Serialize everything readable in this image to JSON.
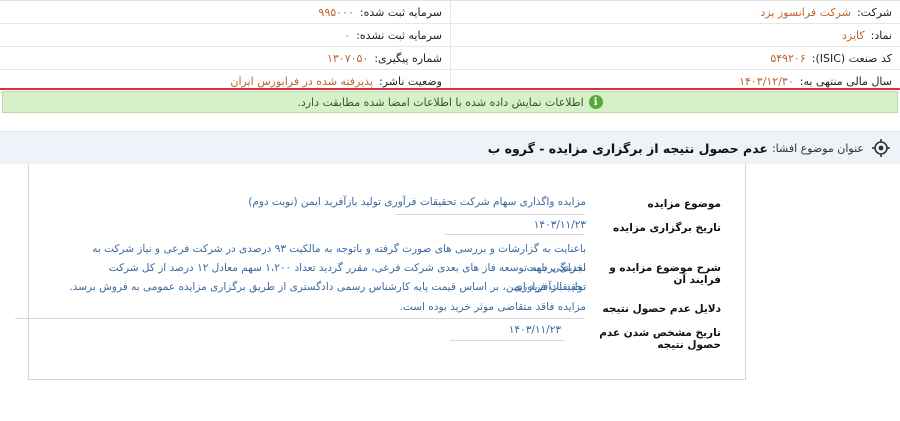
{
  "company_info": {
    "rows": [
      {
        "right": {
          "label": "شرکت:",
          "value": "شرکت فرانسوز یزد"
        },
        "left": {
          "label": "سرمایه ثبت شده:",
          "value": "۹۹۵۰۰۰"
        }
      },
      {
        "right": {
          "label": "نماد:",
          "value": "کایزد"
        },
        "left": {
          "label": "سرمایه ثبت نشده:",
          "value": "۰"
        }
      },
      {
        "right": {
          "label": "کد صنعت (ISIC):",
          "value": "۵۴۹۲۰۶"
        },
        "left": {
          "label": "شماره پیگیری:",
          "value": "۱۳۰۷۰۵۰"
        }
      },
      {
        "right": {
          "label": "سال مالی منتهی به:",
          "value": "۱۴۰۳/۱۲/۳۰"
        },
        "left": {
          "label": "وضعیت ناشر:",
          "value": "پذیرفته شده در فرابورس ایران"
        }
      }
    ]
  },
  "banner": {
    "icon": "info-icon",
    "text": "اطلاعات نمایش داده شده با اطلاعات امضا شده مطابقت دارد."
  },
  "title": {
    "label": "عنوان موضوع افشا:",
    "value": "عدم حصول نتیجه از برگزاری مزایده - گروه ب"
  },
  "fields": [
    {
      "label": "موضوع مزایده",
      "value": "مزایده واگذاری سهام شرکت تحقیقات فرآوری تولید بازآفرید ایمن (نوبت دوم)"
    },
    {
      "label": "تاریخ برگزاری مزایده",
      "value": "۱۴۰۳/۱۱/۲۳"
    },
    {
      "label": "شرح موضوع مزایده و فرایند آن",
      "value_lines": [
        "باعنایت به گزارشات و بررسی های صورت گرفته و باتوجه به مالکیت ۹۳ درصدی در شرکت فرعی و نیاز شرکت به نقدینگی جهت",
        "اجرای برنامه توسعه فاز های بعدی شرکت فرعی، مقرر گردید تعداد ۱،۲۰۰ سهم معادل ۱۲ درصد از کل شرکت تحقیقات فراوری",
        "تولید بازآفرید ایمن، بر اساس قیمت پایه کارشناس رسمی دادگستری از طریق برگزاری مزایده عمومی به فروش برسد."
      ]
    },
    {
      "label": "دلایل عدم حصول نتیجه",
      "value": "مزایده فاقد متقاضی موثر خرید بوده است."
    },
    {
      "label": "تاریخ مشخص شدن عدم حصول نتیجه",
      "value": "۱۴۰۳/۱۱/۲۳"
    }
  ]
}
